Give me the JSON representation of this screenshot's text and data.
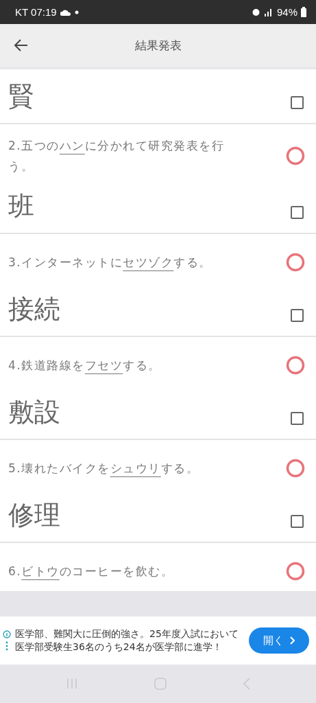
{
  "status_bar": {
    "carrier_time": "KT 07:19",
    "battery": "94%"
  },
  "header": {
    "title": "結果発表"
  },
  "items": [
    {
      "answer": "賢",
      "checked": false
    },
    {
      "number": "2.",
      "before": "五つの",
      "underlined": "ハン",
      "after": "に分かれて研究発表を行う。",
      "correct": true,
      "answer": "班",
      "checked": false
    },
    {
      "number": "3.",
      "before": "インターネットに",
      "underlined": "セツゾク",
      "after": "する。",
      "correct": true,
      "answer": "接続",
      "checked": false
    },
    {
      "number": "4.",
      "before": "鉄道路線を",
      "underlined": "フセツ",
      "after": "する。",
      "correct": true,
      "answer": "敷設",
      "checked": false
    },
    {
      "number": "5.",
      "before": "壊れたバイクを",
      "underlined": "シュウリ",
      "after": "する。",
      "correct": true,
      "answer": "修理",
      "checked": false
    },
    {
      "number": "6.",
      "underlined": "ビトウ",
      "after": "のコーヒーを飲む。",
      "correct": true
    }
  ],
  "ad": {
    "text": "医学部、難関大に圧倒的強さ。25年度入試において医学部受験生36名のうち24名が医学部に進学！",
    "button": "開く"
  }
}
